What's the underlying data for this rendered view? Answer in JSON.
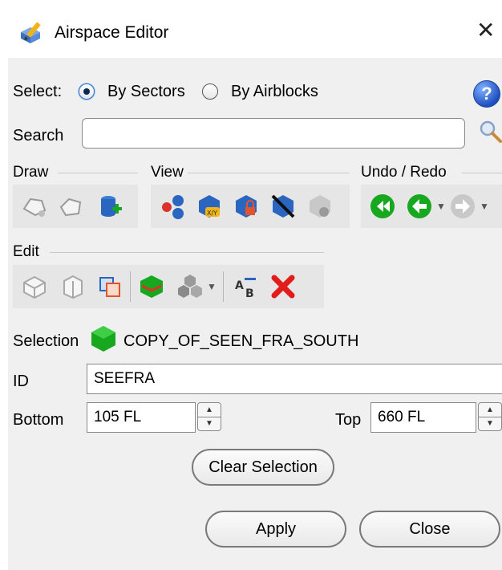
{
  "window": {
    "title": "Airspace Editor",
    "close_glyph": "✕"
  },
  "select": {
    "label": "Select:",
    "options": [
      {
        "label": "By Sectors",
        "checked": true
      },
      {
        "label": "By Airblocks",
        "checked": false
      }
    ],
    "help_glyph": "?"
  },
  "search": {
    "label": "Search",
    "value": "",
    "icon": "magnifier-icon"
  },
  "groups": {
    "draw": {
      "label": "Draw",
      "icons": [
        "draw-sector-icon",
        "draw-polygon-icon",
        "add-volume-icon"
      ]
    },
    "view": {
      "label": "View",
      "icons": [
        "view-network-icon",
        "view-xy-icon",
        "view-locked-icon",
        "view-hide-icon",
        "view-reset-icon"
      ]
    },
    "undo_redo": {
      "label": "Undo / Redo",
      "icons": [
        "undo-all-icon",
        "undo-icon",
        "redo-icon"
      ]
    },
    "edit": {
      "label": "Edit",
      "icons": [
        "edit-cube-icon",
        "edit-cylinder-icon",
        "edit-copy-icon",
        "edit-split-icon",
        "edit-group-icon",
        "rename-icon",
        "delete-icon"
      ]
    }
  },
  "selection": {
    "label": "Selection",
    "value": "COPY_OF_SEEN_FRA_SOUTH"
  },
  "id_field": {
    "label": "ID",
    "value": "SEEFRA"
  },
  "bottom": {
    "label": "Bottom",
    "value": "105 FL"
  },
  "top": {
    "label": "Top",
    "value": "660 FL"
  },
  "buttons": {
    "clear_selection": "Clear Selection",
    "apply": "Apply",
    "close": "Close"
  },
  "colors": {
    "accent_green": "#17a81f",
    "accent_blue": "#1f5fbf",
    "delete_red": "#e21b1b"
  }
}
